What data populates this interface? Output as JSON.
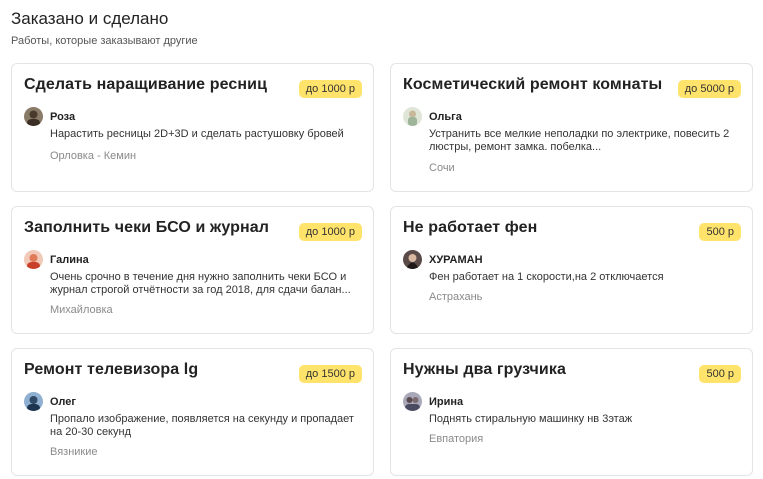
{
  "section": {
    "title": "Заказано и сделано",
    "subtitle": "Работы, которые заказывают другие"
  },
  "cards": [
    {
      "title": "Сделать наращивание ресниц",
      "price": "до 1000 р",
      "author": "Роза",
      "description": "Нарастить ресницы 2D+3D и сделать растушовку бровей",
      "city": "Орловка - Кемин",
      "avatar_color": "#5a4a3a"
    },
    {
      "title": "Косметический ремонт комнаты",
      "price": "до 5000 р",
      "author": "Ольга",
      "description": "Устранить все мелкие неполадки по электрике, повесить 2 люстры, ремонт замка. побелка...",
      "city": "Сочи",
      "avatar_color": "#b8c8b0"
    },
    {
      "title": "Заполнить чеки БСО и журнал",
      "price": "до 1000 р",
      "author": "Галина",
      "description": "Очень срочно в течение дня нужно заполнить чеки БСО и журнал строгой отчётности за год 2018, для сдачи балан...",
      "city": "Михайловка",
      "avatar_color": "#d9664a"
    },
    {
      "title": "Не работает фен",
      "price": "500 р",
      "author": "ХУРАМАН",
      "description": "Фен работает на 1 скорости,на 2 отключается",
      "city": "Астрахань",
      "avatar_color": "#3a3030"
    },
    {
      "title": "Ремонт телевизора lg",
      "price": "до 1500 р",
      "author": "Олег",
      "description": "Пропало изображение, появляется на секунду и пропадает на 20-30 секунд",
      "city": "Вязникие",
      "avatar_color": "#3a5a7a"
    },
    {
      "title": "Нужны два грузчика",
      "price": "500 р",
      "author": "Ирина",
      "description": "Поднять стиральную машинку нв 3этаж",
      "city": "Евпатория",
      "avatar_color": "#6a6a80"
    }
  ]
}
